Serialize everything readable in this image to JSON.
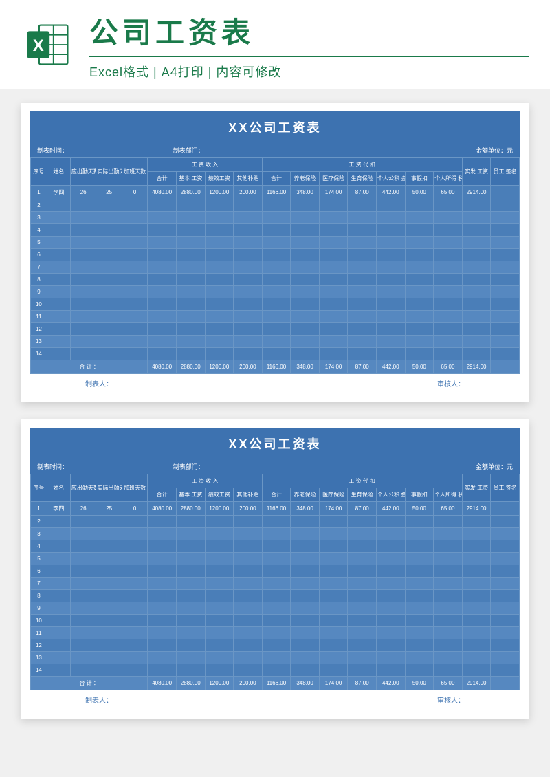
{
  "header": {
    "title": "公司工资表",
    "subtitle": "Excel格式 | A4打印 | 内容可修改"
  },
  "sheet": {
    "title": "XX公司工资表",
    "meta": {
      "time_label": "制表时间：",
      "dept_label": "制表部门：",
      "unit_label": "金额单位：元"
    },
    "columns": {
      "idx": "序号",
      "name": "姓名",
      "should_attend": "应出勤天数",
      "actual_attend": "实际出勤天数",
      "overtime": "加班天数",
      "income_group": "工 资 收 入",
      "deduct_group": "工 资 代 扣",
      "total": "合计",
      "base": "基本 工资",
      "perf": "绩效工资",
      "bonus": "其他补贴",
      "d_total": "合计",
      "pension": "养老保险",
      "medical": "医疗保险",
      "birth": "生育保险",
      "fund": "个人公积 金",
      "leave": "事假扣",
      "tax": "个人所得 税",
      "net": "实发 工资",
      "sign": "员工 签名"
    },
    "rows": [
      {
        "idx": "1",
        "name": "李四",
        "should": "26",
        "actual": "25",
        "ot": "0",
        "total": "4080.00",
        "base": "2880.00",
        "perf": "1200.00",
        "bonus": "200.00",
        "dtotal": "1166.00",
        "pension": "348.00",
        "medical": "174.00",
        "birth": "87.00",
        "fund": "442.00",
        "leave": "50.00",
        "tax": "65.00",
        "net": "2914.00",
        "sign": ""
      },
      {
        "idx": "2"
      },
      {
        "idx": "3"
      },
      {
        "idx": "4"
      },
      {
        "idx": "5"
      },
      {
        "idx": "6"
      },
      {
        "idx": "7"
      },
      {
        "idx": "8"
      },
      {
        "idx": "9"
      },
      {
        "idx": "10"
      },
      {
        "idx": "11"
      },
      {
        "idx": "12"
      },
      {
        "idx": "13"
      },
      {
        "idx": "14"
      }
    ],
    "sum": {
      "label": "合 计 ：",
      "total": "4080.00",
      "base": "2880.00",
      "perf": "1200.00",
      "bonus": "200.00",
      "dtotal": "1166.00",
      "pension": "348.00",
      "medical": "174.00",
      "birth": "87.00",
      "fund": "442.00",
      "leave": "50.00",
      "tax": "65.00",
      "net": "2914.00"
    },
    "footer": {
      "preparer": "制表人：",
      "reviewer": "审核人："
    }
  }
}
